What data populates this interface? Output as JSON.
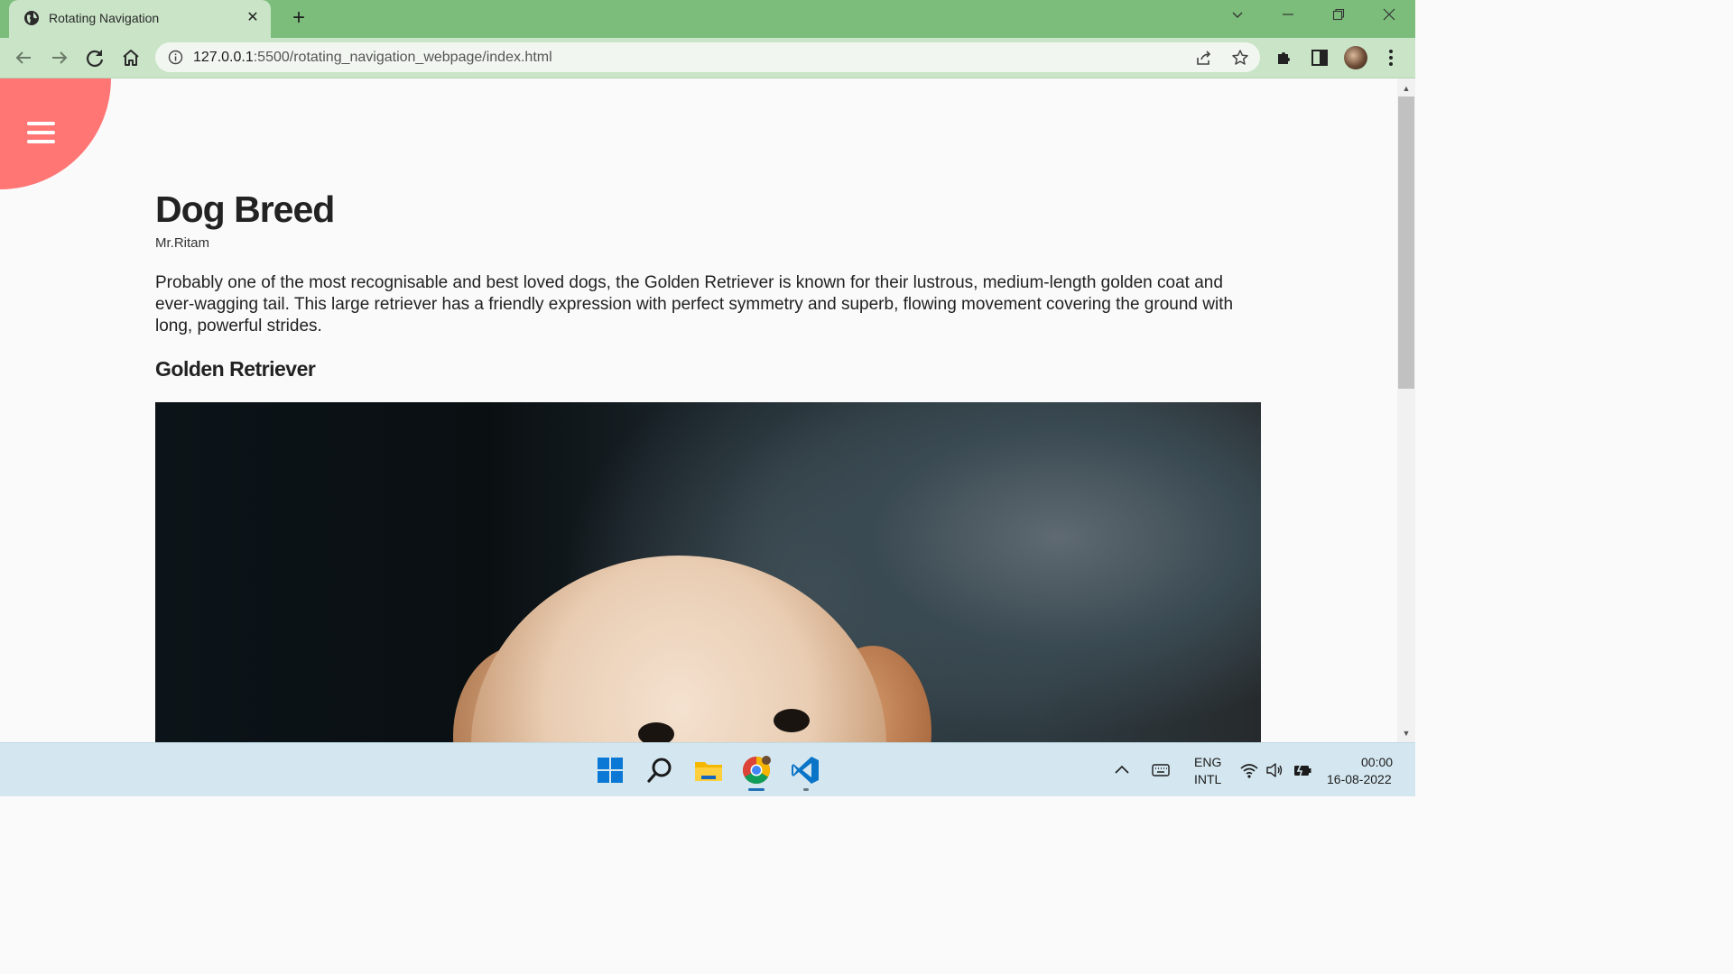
{
  "browser": {
    "tab_title": "Rotating Navigation",
    "url_host": "127.0.0.1",
    "url_rest": ":5500/rotating_navigation_webpage/index.html"
  },
  "page": {
    "title": "Dog Breed",
    "author": "Mr.Ritam",
    "paragraph": "Probably one of the most recognisable and best loved dogs, the Golden Retriever is known for their lustrous, medium-length golden coat and ever-wagging tail. This large retriever has a friendly expression with perfect symmetry and superb, flowing movement covering the ground with long, powerful strides.",
    "subheading": "Golden Retriever",
    "accent_color": "#ff7675"
  },
  "taskbar": {
    "lang_top": "ENG",
    "lang_bottom": "INTL",
    "time": "00:00",
    "date": "16-08-2022"
  }
}
